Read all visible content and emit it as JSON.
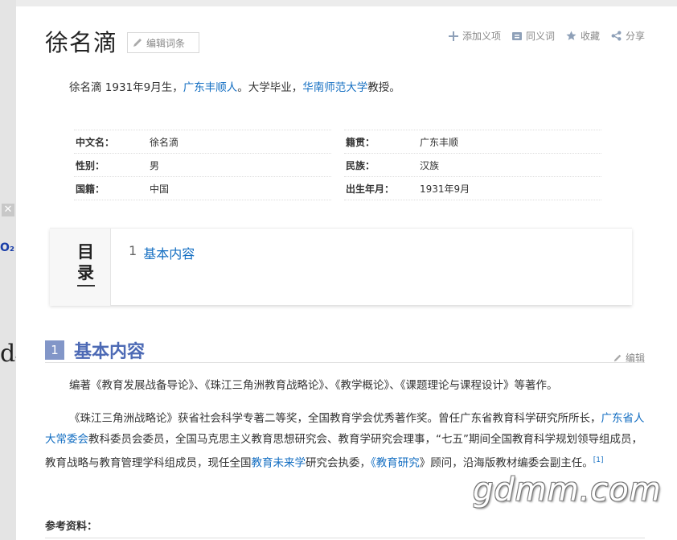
{
  "side": {
    "o2_text": "O₂"
  },
  "header": {
    "title": "徐名滴",
    "edit_entry_label": "编辑词条",
    "actions": [
      {
        "label": "添加义项",
        "icon": "plus-icon"
      },
      {
        "label": "同义词",
        "icon": "synonym-icon"
      },
      {
        "label": "收藏",
        "icon": "star-icon"
      },
      {
        "label": "分享",
        "icon": "share-icon"
      }
    ]
  },
  "lead": {
    "part1": "徐名滴 1931年9月生，",
    "link1": "广东丰顺人",
    "part2": "。大学毕业，",
    "link2": "华南师范大学",
    "part3": "教授。"
  },
  "basic_info": {
    "left": [
      {
        "name": "中文名：",
        "value": "徐名滴"
      },
      {
        "name": "性别：",
        "value": "男"
      },
      {
        "name": "国籍：",
        "value": "中国"
      }
    ],
    "right": [
      {
        "name": "籍贯：",
        "value": "广东丰顺"
      },
      {
        "name": "民族：",
        "value": "汉族"
      },
      {
        "name": "出生年月：",
        "value": "1931年9月"
      }
    ]
  },
  "toc": {
    "title_line1": "目",
    "title_line2": "录",
    "items": [
      {
        "num": "1",
        "label": "基本内容"
      }
    ]
  },
  "section": {
    "num": "1",
    "title": "基本内容",
    "edit_label": "编辑"
  },
  "para1": "编著《教育发展战备导论》、《珠江三角洲教育战略论》、《教学概论》、《课题理论与课程设计》等著作。",
  "para2": {
    "t1": "《珠江三角洲战略论》获省社会科学专著二等奖，全国教育学会优秀著作奖。曾任广东省教育科学研究所所长，",
    "link1": "广东省人大常委会",
    "t2": "教科委员会委员，全国马克思主义教育思想研究会、教育学研究会理事，“七五”期间全国教育科学规划领导组成员，教育战略与教育管理学科组成员，现任全国",
    "link2": "教育未来学",
    "t3": "研究会执委，",
    "t4": "《",
    "link3": "教育研究",
    "t5": "》顾问，沿海版教材编委会副主任。",
    "ref": "[1]"
  },
  "references_label": "参考资料：",
  "watermark": "gdmm.com"
}
